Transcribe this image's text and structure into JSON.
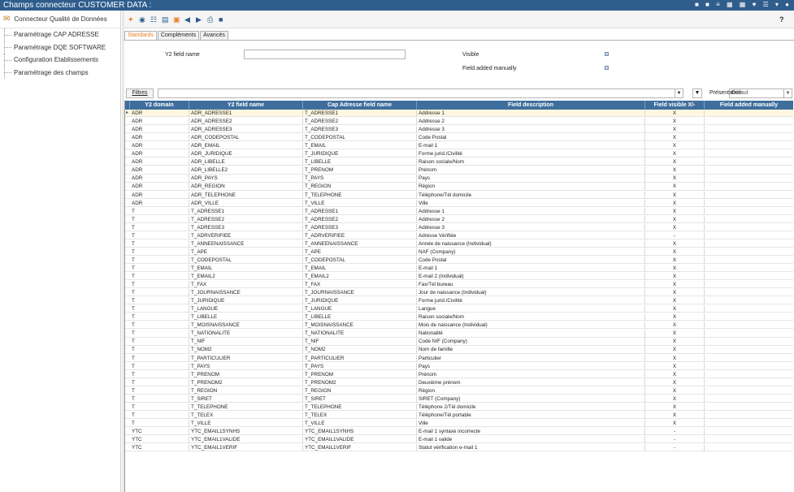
{
  "window": {
    "title": "Champs connecteur CUSTOMER DATA :",
    "title_icons": "■ ■ ≡ ▦ ▦ ♥ ☰ ▾ ●"
  },
  "sidebar": {
    "header": "Connecteur Qualité de Données",
    "items": [
      {
        "label": "Paramétrage CAP ADRESSE"
      },
      {
        "label": "Paramétrage DQE SOFTWARE"
      },
      {
        "label": "Configuration Etablissements"
      },
      {
        "label": "Paramétrage des champs"
      }
    ]
  },
  "toolbar": {
    "help": "?"
  },
  "tabs": [
    {
      "label": "Standards"
    },
    {
      "label": "Compléments"
    },
    {
      "label": "Avancés"
    }
  ],
  "form": {
    "y2_field_name_label": "Y2 field name",
    "y2_field_name_value": "",
    "visible_label": "Visible",
    "added_manually_label": "Field added manually"
  },
  "filterbar": {
    "filters_button": "Filtres",
    "presentation_label": "Présentation",
    "presentation_value": "Défaut"
  },
  "grid": {
    "columns": [
      "Y2 domain",
      "Y2 field name",
      "Cap Adresse field name",
      "Field description",
      "Field visible X/-",
      "Field added manually"
    ],
    "rows": [
      [
        "ADR",
        "ADR_ADRESSE1",
        "T_ADRESSE1",
        "Addresse 1",
        "X",
        ""
      ],
      [
        "ADR",
        "ADR_ADRESSE2",
        "T_ADRESSE2",
        "Addresse 2",
        "X",
        ""
      ],
      [
        "ADR",
        "ADR_ADRESSE3",
        "T_ADRESSE3",
        "Addresse 3",
        "X",
        ""
      ],
      [
        "ADR",
        "ADR_CODEPOSTAL",
        "T_CODEPOSTAL",
        "Code Postal",
        "X",
        ""
      ],
      [
        "ADR",
        "ADR_EMAIL",
        "T_EMAIL",
        "E-mail 1",
        "X",
        ""
      ],
      [
        "ADR",
        "ADR_JURIDIQUE",
        "T_JURIDIQUE",
        "Forme jurid./Civilité",
        "X",
        ""
      ],
      [
        "ADR",
        "ADR_LIBELLE",
        "T_LIBELLE",
        "Raison sociale/Nom",
        "X",
        ""
      ],
      [
        "ADR",
        "ADR_LIBELLE2",
        "T_PRENOM",
        "Prénom",
        "X",
        ""
      ],
      [
        "ADR",
        "ADR_PAYS",
        "T_PAYS",
        "Pays",
        "X",
        ""
      ],
      [
        "ADR",
        "ADR_REGION",
        "T_REGION",
        "Région",
        "X",
        ""
      ],
      [
        "ADR",
        "ADR_TELEPHONE",
        "T_TELEPHONE",
        "Téléphone/Tél domicile",
        "X",
        ""
      ],
      [
        "ADR",
        "ADR_VILLE",
        "T_VILLE",
        "Ville",
        "X",
        ""
      ],
      [
        "T",
        "T_ADRESSE1",
        "T_ADRESSE1",
        "Addresse 1",
        "X",
        ""
      ],
      [
        "T",
        "T_ADRESSE2",
        "T_ADRESSE2",
        "Addresse 2",
        "X",
        ""
      ],
      [
        "T",
        "T_ADRESSE3",
        "T_ADRESSE3",
        "Addresse 3",
        "X",
        ""
      ],
      [
        "T",
        "T_ADRVERIFIEE",
        "T_ADRVERIFIEE",
        "Adresse Vérifiée",
        "-",
        ""
      ],
      [
        "T",
        "T_ANNEENAISSANCE",
        "T_ANNEENAISSANCE",
        "Année de naissance (Individual)",
        "X",
        ""
      ],
      [
        "T",
        "T_APE",
        "T_APE",
        "NAF (Company)",
        "X",
        ""
      ],
      [
        "T",
        "T_CODEPOSTAL",
        "T_CODEPOSTAL",
        "Code Postal",
        "X",
        ""
      ],
      [
        "T",
        "T_EMAIL",
        "T_EMAIL",
        "E-mail 1",
        "X",
        ""
      ],
      [
        "T",
        "T_EMAIL2",
        "T_EMAIL2",
        "E-mail 2 (Individual)",
        "X",
        ""
      ],
      [
        "T",
        "T_FAX",
        "T_FAX",
        "Fax/Tél bureau",
        "X",
        ""
      ],
      [
        "T",
        "T_JOURNAISSANCE",
        "T_JOURNAISSANCE",
        "Jour de naissance (Individual)",
        "X",
        ""
      ],
      [
        "T",
        "T_JURIDIQUE",
        "T_JURIDIQUE",
        "Forme jurid./Civilité",
        "X",
        ""
      ],
      [
        "T",
        "T_LANGUE",
        "T_LANGUE",
        "Langue",
        "X",
        ""
      ],
      [
        "T",
        "T_LIBELLE",
        "T_LIBELLE",
        "Raison sociale/Nom",
        "X",
        ""
      ],
      [
        "T",
        "T_MOISNAISSANCE",
        "T_MOISNAISSANCE",
        "Mois de naissance (Individual)",
        "X",
        ""
      ],
      [
        "T",
        "T_NATIONALITE",
        "T_NATIONALITE",
        "Nationalité",
        "X",
        ""
      ],
      [
        "T",
        "T_NIF",
        "T_NIF",
        "Code NIF (Company)",
        "X",
        ""
      ],
      [
        "T",
        "T_NOM2",
        "T_NOM2",
        "Nom de famille",
        "X",
        ""
      ],
      [
        "T",
        "T_PARTICULIER",
        "T_PARTICULIER",
        "Particulier",
        "X",
        ""
      ],
      [
        "T",
        "T_PAYS",
        "T_PAYS",
        "Pays",
        "X",
        ""
      ],
      [
        "T",
        "T_PRENOM",
        "T_PRENOM",
        "Prénom",
        "X",
        ""
      ],
      [
        "T",
        "T_PRENOM2",
        "T_PRENOM2",
        "Deuxième prénom",
        "X",
        ""
      ],
      [
        "T",
        "T_REGION",
        "T_REGION",
        "Région",
        "X",
        ""
      ],
      [
        "T",
        "T_SIRET",
        "T_SIRET",
        "SIRET (Company)",
        "X",
        ""
      ],
      [
        "T",
        "T_TELEPHONE",
        "T_TELEPHONE",
        "Téléphone 2/Tél domicile",
        "X",
        ""
      ],
      [
        "T",
        "T_TELEX",
        "T_TELEX",
        "Téléphone/Tél portable",
        "X",
        ""
      ],
      [
        "T",
        "T_VILLE",
        "T_VILLE",
        "Ville",
        "X",
        ""
      ],
      [
        "YTC",
        "YTC_EMAIL1SYNHS",
        "YTC_EMAIL1SYNHS",
        "E-mail 1 syntaxe incorrecte",
        "-",
        ""
      ],
      [
        "YTC",
        "YTC_EMAIL1VALIDE",
        "YTC_EMAIL1VALIDE",
        "E-mail 1 valide",
        "-",
        ""
      ],
      [
        "YTC",
        "YTC_EMAIL1VERIF",
        "YTC_EMAIL1VERIF",
        "Statut vérification e-mail 1",
        "-",
        ""
      ]
    ]
  }
}
